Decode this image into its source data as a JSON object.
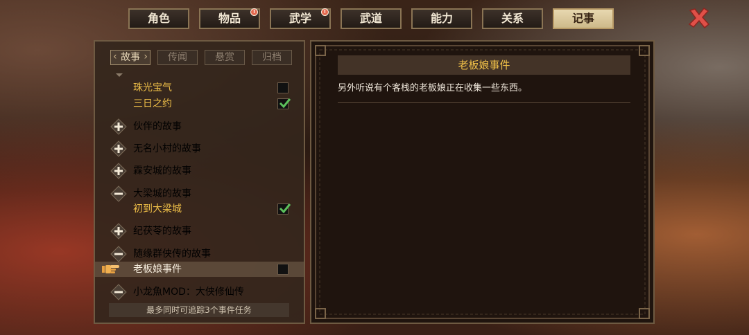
{
  "top_tabs": [
    {
      "label": "角色",
      "badge": false,
      "active": false
    },
    {
      "label": "物品",
      "badge": true,
      "active": false
    },
    {
      "label": "武学",
      "badge": true,
      "active": false
    },
    {
      "label": "武道",
      "badge": false,
      "active": false
    },
    {
      "label": "能力",
      "badge": false,
      "active": false
    },
    {
      "label": "关系",
      "badge": false,
      "active": false
    },
    {
      "label": "记事",
      "badge": false,
      "active": true
    }
  ],
  "badge_glyph": "!",
  "sub_tabs": [
    {
      "label": "故事",
      "active": true
    },
    {
      "label": "传闻",
      "active": false
    },
    {
      "label": "悬赏",
      "active": false
    },
    {
      "label": "归档",
      "active": false
    }
  ],
  "list": [
    {
      "kind": "sub",
      "label": "珠光宝气",
      "checked": false
    },
    {
      "kind": "sub",
      "label": "三日之约",
      "checked": true
    },
    {
      "kind": "group",
      "label": "伙伴的故事",
      "expanded": false
    },
    {
      "kind": "group",
      "label": "无名小村的故事",
      "expanded": false
    },
    {
      "kind": "group",
      "label": "霖安城的故事",
      "expanded": false
    },
    {
      "kind": "group",
      "label": "大梁城的故事",
      "expanded": true
    },
    {
      "kind": "sub",
      "label": "初到大梁城",
      "checked": true
    },
    {
      "kind": "group",
      "label": "纪茯苓的故事",
      "expanded": false
    },
    {
      "kind": "group",
      "label": "随缘群侠传的故事",
      "expanded": true
    },
    {
      "kind": "sub",
      "label": "老板娘事件",
      "checked": false,
      "selected": true
    },
    {
      "kind": "group",
      "label": "小龙魚MOD：大侠修仙传",
      "expanded": true
    }
  ],
  "footer_note": "最多同时可追踪3个事件任务",
  "detail": {
    "title": "老板娘事件",
    "description": "另外听说有个客栈的老板娘正在收集一些东西。"
  },
  "colors": {
    "gold_text": "#f0c048",
    "active_tab": "#e8d8b0",
    "close_x": "#e05048",
    "check_green": "#5cc05c"
  }
}
